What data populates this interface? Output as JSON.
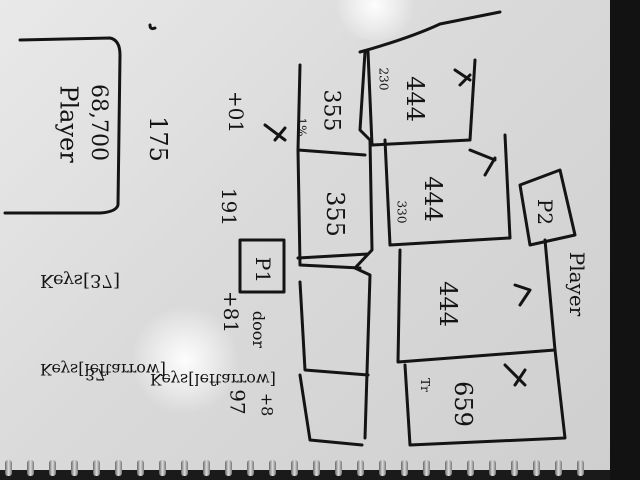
{
  "colors": {
    "paper": "#e3e3e3",
    "ink": "#141414",
    "background": "#121212"
  },
  "player_box": {
    "title": "Player",
    "score": "68,700"
  },
  "top_note": {
    "value": "175"
  },
  "cells": [
    {
      "main": "444",
      "small": "230"
    },
    {
      "main": "444",
      "small": "330"
    },
    {
      "main": "444",
      "small": ""
    },
    {
      "main": "659",
      "small": "Tr"
    },
    {
      "main": "355",
      "small": ""
    },
    {
      "main": "355",
      "small": "1%"
    }
  ],
  "side_marks": {
    "a": "+01",
    "b": "191",
    "c": "+81",
    "d": "97",
    "tag_p1": "P1",
    "tag_p2": "P2",
    "player2_label": "Player",
    "door": "door",
    "mark": "+8"
  },
  "notes": {
    "line1": "Keys[leftarrow]",
    "line2": "37",
    "line3": "Keys[37]",
    "line4": "Keys[leftarrow]"
  }
}
